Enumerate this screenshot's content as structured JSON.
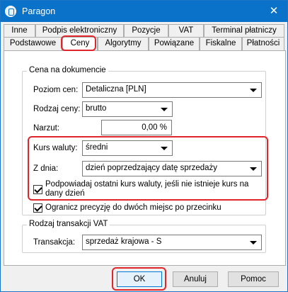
{
  "window": {
    "title": "Paragon",
    "close_glyph": "✕"
  },
  "tabs_row1": [
    "Inne",
    "Podpis elektroniczny",
    "Pozycje",
    "VAT",
    "Terminal płatniczy"
  ],
  "tabs_row2": [
    "Podstawowe",
    "Ceny",
    "Algorytmy",
    "Powiązane",
    "Fiskalne",
    "Płatności"
  ],
  "active_tab": "Ceny",
  "price_group": {
    "title": "Cena na dokumencie",
    "poziom_label": "Poziom cen:",
    "poziom_value": "Detaliczna [PLN]",
    "rodzaj_label": "Rodzaj ceny:",
    "rodzaj_value": "brutto",
    "narzut_label": "Narzut:",
    "narzut_value": "0,00 %",
    "kurs_label": "Kurs waluty:",
    "kurs_value": "średni",
    "zdnia_label": "Z dnia:",
    "zdnia_value": "dzień poprzedzający datę sprzedaży",
    "suggest_label_line1": "Podpowiadaj ostatni kurs waluty, jeśli nie istnieje kurs na",
    "suggest_label_line2": "dany dzień",
    "suggest_checked": true,
    "precision_label": "Ogranicz precyzję do dwóch miejsc po przecinku",
    "precision_checked": true
  },
  "vat_group": {
    "title": "Rodzaj transakcji VAT",
    "transakcja_label": "Transakcja:",
    "transakcja_value": "sprzedaż krajowa - S"
  },
  "buttons": {
    "ok": "OK",
    "cancel": "Anuluj",
    "help": "Pomoc"
  },
  "colors": {
    "titlebar": "#0a72c9",
    "highlight": "#e0262b"
  }
}
